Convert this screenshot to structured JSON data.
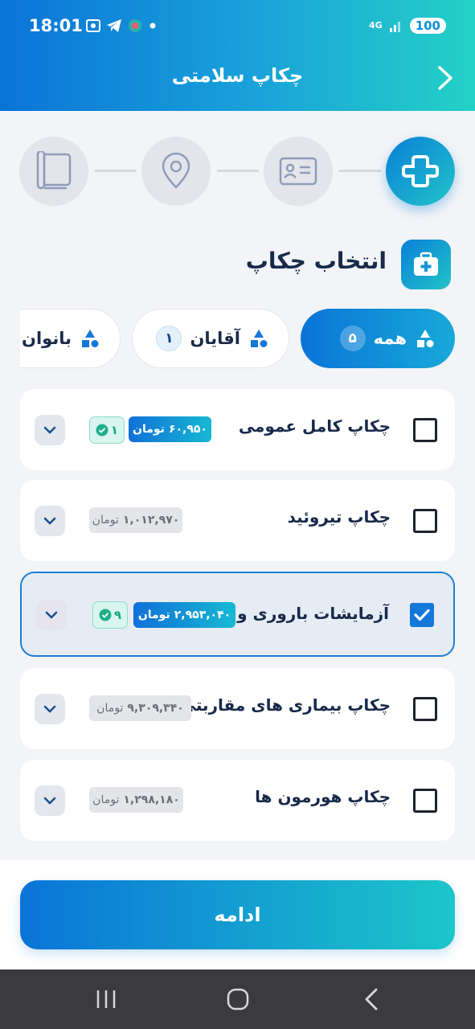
{
  "status_bar": {
    "time": "18:01",
    "battery": "100",
    "network": "4G"
  },
  "header": {
    "title": "چکاپ سلامتی"
  },
  "steps": [
    {
      "icon": "medical-cross-icon",
      "active": true
    },
    {
      "icon": "id-card-icon",
      "active": false
    },
    {
      "icon": "location-pin-icon",
      "active": false
    },
    {
      "icon": "document-icon",
      "active": false
    }
  ],
  "section": {
    "title": "انتخاب چکاپ",
    "icon": "medical-kit-icon"
  },
  "tabs": [
    {
      "label": "همه",
      "count": "۵",
      "active": true
    },
    {
      "label": "آقایان",
      "count": "۱",
      "active": false
    },
    {
      "label": "بانوان",
      "count": "",
      "active": false
    }
  ],
  "checkups": [
    {
      "name": "چکاپ کامل عمومی",
      "price": "۶۰,۹۵۰",
      "unit": "تومان",
      "badge": "۱",
      "selected": false,
      "highlight": true
    },
    {
      "name": "چکاپ تیروئید",
      "price": "۱,۰۱۲,۹۷۰",
      "unit": "تومان",
      "badge": "",
      "selected": false,
      "highlight": false
    },
    {
      "name": "آزمایشات باروری و ...",
      "price": "۲,۹۵۳,۰۴۰",
      "unit": "تومان",
      "badge": "۹",
      "selected": true,
      "highlight": true
    },
    {
      "name": "چکاپ بیماری های مقاربتی",
      "price": "۹,۳۰۹,۳۴۰",
      "unit": "تومان",
      "badge": "",
      "selected": false,
      "highlight": false
    },
    {
      "name": "چکاپ هورمون ها",
      "price": "۱,۲۹۸,۱۸۰",
      "unit": "تومان",
      "badge": "",
      "selected": false,
      "highlight": false
    }
  ],
  "continue_button": {
    "label": "ادامه"
  },
  "colors": {
    "accent": "#0a74d8",
    "accent_end": "#24d1c6",
    "badge_green": "#18a884"
  }
}
